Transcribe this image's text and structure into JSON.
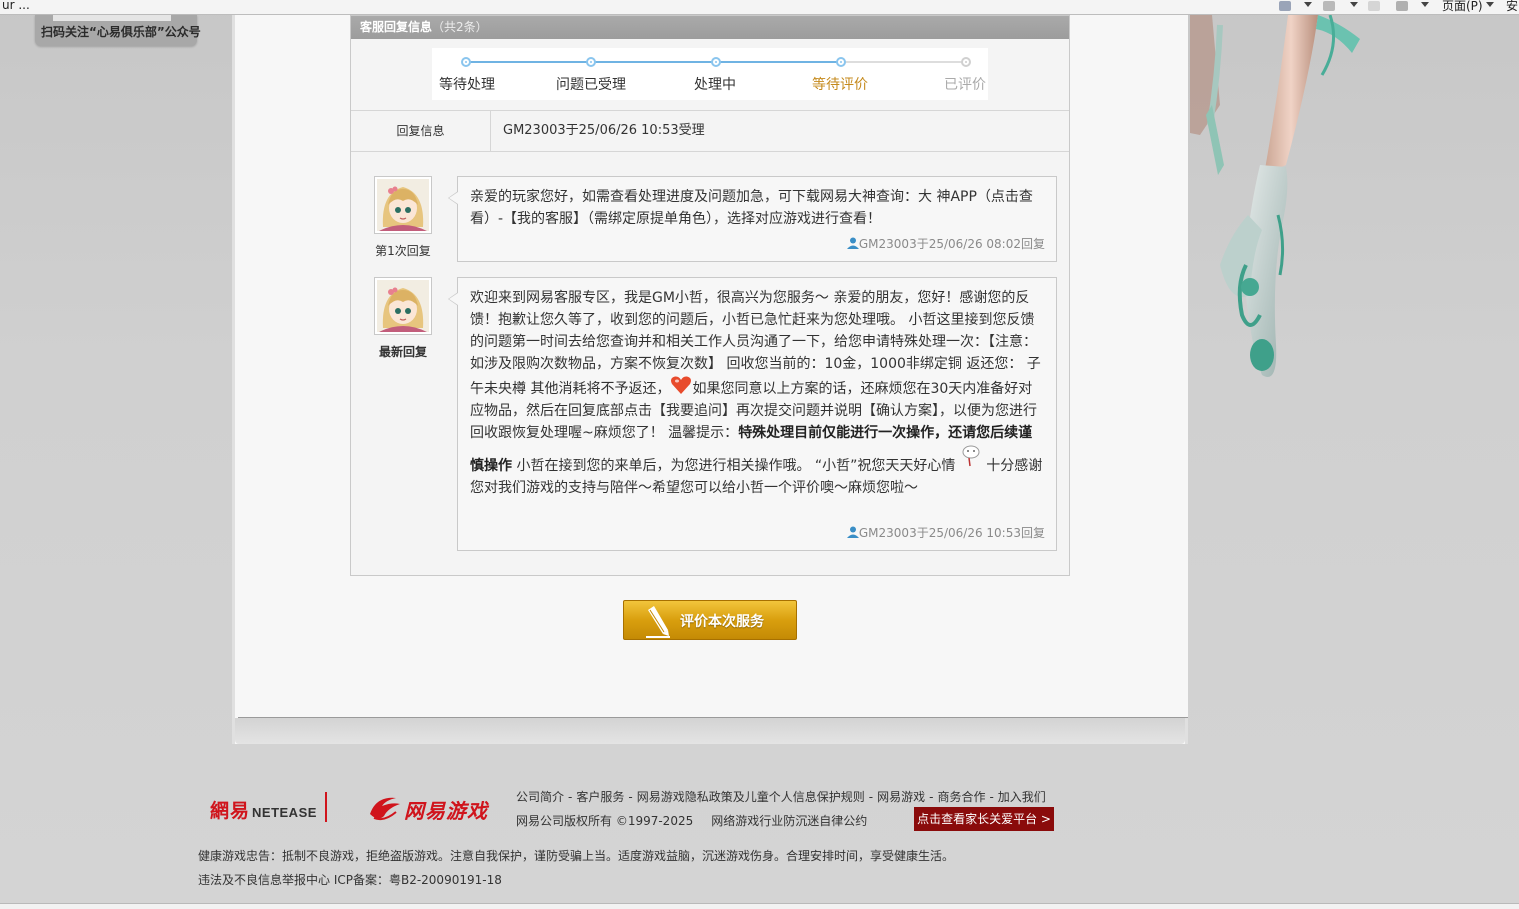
{
  "browser": {
    "left_text": "ur ...",
    "page_menu": "页面(P)",
    "far_right": "安"
  },
  "qr_tag": {
    "text": "扫码关注“心易俱乐部”公众号"
  },
  "reply_box": {
    "title": "客服回复信息",
    "count": "（共2条）"
  },
  "progress": {
    "steps": [
      "等待处理",
      "问题已受理",
      "处理中",
      "等待评价",
      "已评价"
    ],
    "current_index": 3
  },
  "info": {
    "label": "回复信息",
    "value": "GM23003于25/06/26 10:53受理"
  },
  "replies": [
    {
      "caption": "第1次回复",
      "text": "亲爱的玩家您好，如需查看处理进度及问题加急，可下载网易大神查询：大 神APP（点击查看）-【我的客服】（需绑定原提单角色），选择对应游戏进行查看！",
      "signature": "GM23003于25/06/26 08:02回复"
    },
    {
      "caption": "最新回复",
      "text_p1": "欢迎来到网易客服专区，我是GM小哲，很高兴为您服务～  亲爱的朋友，您好！感谢您的反馈！抱歉让您久等了，收到您的问题后，小哲已急忙赶来为您处理哦。    小哲这里接到您反馈的问题第一时间去给您查询并和相关工作人员沟通了一下，给您申请特殊处理一次：【注意：如涉及限购次数物品，方案不恢复次数】    回收您当前的：10金，1000非绑定铜    返还您： 子午未央樽 其他消耗将不予返还，",
      "text_p2": "如果您同意以上方案的话，还麻烦您在30天内准备好对应物品，然后在回复底部点击【我要追问】再次提交问题并说明【确认方案】，以便为您进行回收跟恢复处理喔~麻烦您了！ 温馨提示：",
      "text_bold": "特殊处理目前仅能进行一次操作，还请您后续谨慎操作",
      "text_p3": " 小哲在接到您的来单后，为您进行相关操作哦。    “小哲”祝您天天好心情 ",
      "text_p4": " 十分感谢您对我们游戏的支持与陪伴～希望您可以给小哲一个评价噢～麻烦您啦～",
      "signature": "GM23003于25/06/26 10:53回复"
    }
  ],
  "evaluate_button": {
    "label": "评价本次服务"
  },
  "footer": {
    "logo_cn": "網易",
    "logo_en": "NETEASE",
    "games_logo": "网易游戏",
    "links": [
      "公司简介",
      "客户服务",
      "网易游戏隐私政策及儿童个人信息保护规则",
      "网易游戏",
      "商务合作",
      "加入我们"
    ],
    "copyright": "网易公司版权所有 ©1997-2025",
    "self_discipline": "网络游戏行业防沉迷自律公约",
    "parent_button": "点击查看家长关爱平台 >",
    "health": "健康游戏忠告：抵制不良游戏，拒绝盗版游戏。注意自我保护，谨防受骗上当。适度游戏益脑，沉迷游戏伤身。合理安排时间，享受健康生活。",
    "icp": "违法及不良信息举报中心 ICP备案：粤B2-20090191-18"
  },
  "colors": {
    "accent_blue": "#6fb3e3",
    "current_step": "#c58a1c",
    "button_gold": "#d99f0e",
    "netease_red": "#d0141c",
    "parent_btn": "#8a0b0b"
  }
}
